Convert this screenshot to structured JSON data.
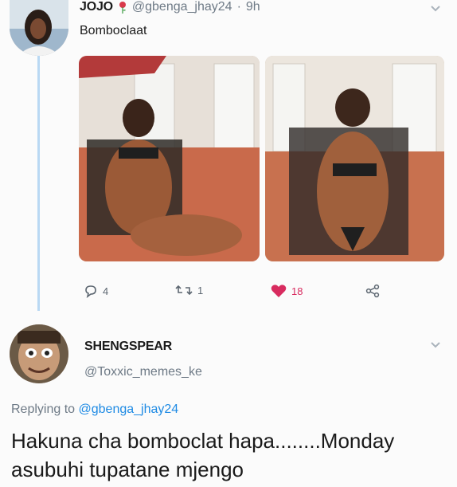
{
  "tweet": {
    "display_name": "JOJO",
    "handle": "@gbenga_jhay24",
    "separator": "·",
    "time": "9h",
    "text": "Bomboclaat",
    "actions": {
      "reply_count": "4",
      "retweet_count": "1",
      "like_count": "18"
    },
    "icons": {
      "name_emoji": "rose-icon",
      "reply": "comment-icon",
      "retweet": "retweet-icon",
      "like": "heart-icon",
      "share": "share-icon",
      "menu": "chevron-down-icon"
    }
  },
  "reply": {
    "display_name": "SHENGSPEAR",
    "handle": "@Toxxic_memes_ke",
    "replying_to_label": "Replying to",
    "replying_to_handle": "@gbenga_jhay24",
    "text": "Hakuna cha bomboclat hapa........Monday asubuhi tupatane mjengo"
  },
  "colors": {
    "background": "#fbfbfb",
    "accent_blue": "#1d8ae4",
    "like_red": "#d82b5f",
    "thread_line": "#b9d8f3",
    "muted": "#6e7a86"
  }
}
